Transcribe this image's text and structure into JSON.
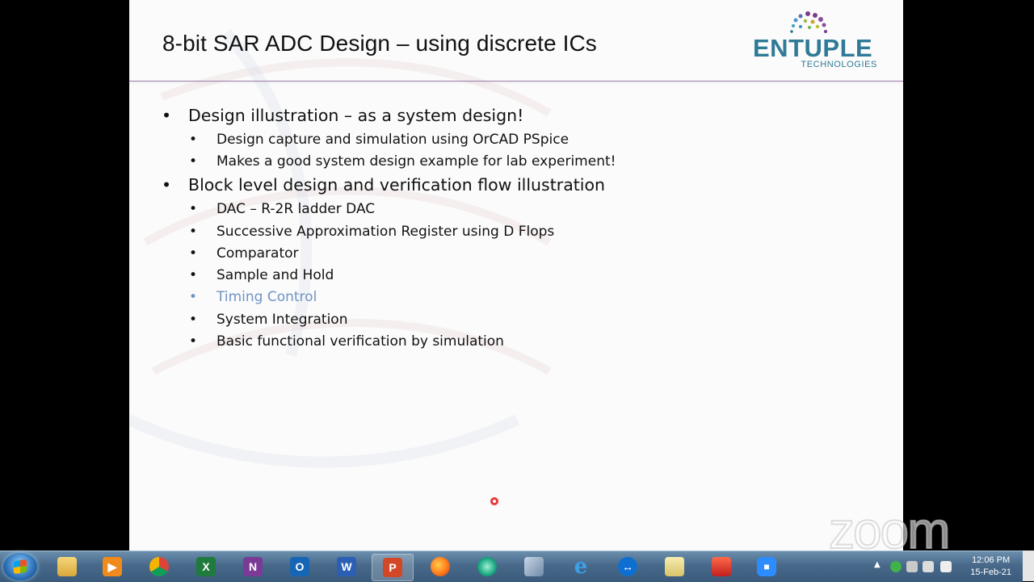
{
  "slide": {
    "title": "8-bit SAR ADC Design – using discrete ICs",
    "logo": {
      "name": "ENTUPLE",
      "sub": "TECHNOLOGIES"
    },
    "bullets": [
      {
        "level": 1,
        "text": "Design illustration – as a system design!"
      },
      {
        "level": 2,
        "text": "Design capture and simulation using OrCAD PSpice"
      },
      {
        "level": 2,
        "text": "Makes a good system design example for lab experiment!"
      },
      {
        "level": 1,
        "text": "Block level design and verification flow illustration"
      },
      {
        "level": 2,
        "text": "DAC – R-2R ladder DAC"
      },
      {
        "level": 2,
        "text": "Successive Approximation Register using D Flops"
      },
      {
        "level": 2,
        "text": "Comparator"
      },
      {
        "level": 2,
        "text": "Sample and Hold"
      },
      {
        "level": 2,
        "text": "Timing Control",
        "muted": true
      },
      {
        "level": 2,
        "text": "System Integration"
      },
      {
        "level": 2,
        "text": "Basic functional verification by simulation"
      }
    ]
  },
  "overlay": {
    "zoom_mark": "zoom"
  },
  "taskbar": {
    "apps": [
      {
        "name": "file-explorer",
        "glyph": ""
      },
      {
        "name": "media-player",
        "glyph": "▶"
      },
      {
        "name": "chrome",
        "glyph": ""
      },
      {
        "name": "excel",
        "glyph": "X"
      },
      {
        "name": "onenote",
        "glyph": "N"
      },
      {
        "name": "outlook",
        "glyph": "O"
      },
      {
        "name": "word",
        "glyph": "W"
      },
      {
        "name": "powerpoint",
        "glyph": "P"
      },
      {
        "name": "firefox",
        "glyph": ""
      },
      {
        "name": "app-green",
        "glyph": ""
      },
      {
        "name": "virtualbox",
        "glyph": ""
      },
      {
        "name": "internet-explorer",
        "glyph": "e"
      },
      {
        "name": "teamviewer",
        "glyph": "↔"
      },
      {
        "name": "folder",
        "glyph": ""
      },
      {
        "name": "app-red",
        "glyph": ""
      },
      {
        "name": "zoom",
        "glyph": "■"
      }
    ],
    "clock": {
      "time": "12:06 PM",
      "date": "15-Feb-21"
    }
  },
  "colors": {
    "logo": "#2f7a96",
    "muted_bullet": "#6f93c4",
    "title_rule": "#9a7aa9"
  }
}
